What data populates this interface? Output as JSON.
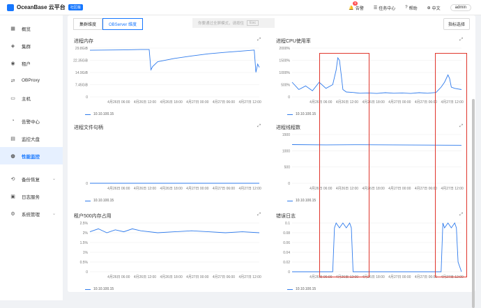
{
  "brand": {
    "name": "OceanBase 云平台",
    "edition": "社区版"
  },
  "topbar": {
    "alerts_label": "告警",
    "alerts_count": "9",
    "tasks_label": "任务中心",
    "help_label": "帮助",
    "lang_label": "中文",
    "user": "admin"
  },
  "sidebar": {
    "items": [
      {
        "label": "概览",
        "icon": "grid-icon"
      },
      {
        "label": "集群",
        "icon": "cluster-icon"
      },
      {
        "label": "租户",
        "icon": "tenant-icon"
      },
      {
        "label": "OBProxy",
        "icon": "proxy-icon"
      },
      {
        "label": "主机",
        "icon": "host-icon"
      },
      {
        "label": "告警中心",
        "icon": "bell-icon"
      },
      {
        "label": "监控大盘",
        "icon": "dashboard-icon"
      },
      {
        "label": "性能监控",
        "icon": "performance-icon",
        "active": true
      },
      {
        "label": "备份恢复",
        "icon": "backup-icon",
        "chevron": true
      },
      {
        "label": "日志服务",
        "icon": "log-icon"
      },
      {
        "label": "系统管理",
        "icon": "settings-icon",
        "chevron": true
      }
    ]
  },
  "tabs": [
    {
      "label": "集群维度"
    },
    {
      "label": "OBServer 维度",
      "selected": true
    }
  ],
  "toast": {
    "text": "你要通过全屏模式，请按住",
    "key": "Esc"
  },
  "metric_button": "指标选择",
  "legend_host": "10.10.100.15",
  "colors": {
    "line": "#2f7bec",
    "accent": "#1677ff",
    "highlight": "#e0352b"
  },
  "chart_data": [
    {
      "title": "进程内存",
      "type": "line",
      "y_ticks": [
        "29.8GiB",
        "22.35GiB",
        "14.9GiB",
        "7.45GiB",
        "0"
      ],
      "ylim": [
        0,
        29.8
      ],
      "x_ticks": [
        "4月26日 06:00",
        "4月26日 12:00",
        "4月26日 18:00",
        "4月27日 00:00",
        "4月27日 06:00",
        "4月27日 12:00"
      ],
      "series": [
        {
          "name": "10.10.100.15",
          "x": [
            0,
            0.1,
            0.2,
            0.3,
            0.35,
            0.36,
            0.37,
            0.4,
            0.5,
            0.6,
            0.7,
            0.8,
            0.9,
            0.97,
            0.98,
            0.99,
            1.0
          ],
          "values": [
            28.5,
            28.6,
            28.7,
            28.9,
            28.9,
            16.5,
            18.5,
            21.5,
            23.5,
            25.0,
            26.3,
            27.2,
            28.0,
            28.6,
            15.0,
            20.0,
            18.0
          ]
        }
      ]
    },
    {
      "title": "进程CPU使用率",
      "type": "line",
      "y_ticks": [
        "2000%",
        "1500%",
        "1000%",
        "500%",
        "0"
      ],
      "ylim": [
        0,
        2000
      ],
      "x_ticks": [
        "4月26日 06:00",
        "4月26日 12:00",
        "4月26日 18:00",
        "4月27日 00:00",
        "4月27日 06:00",
        "4月27日 12:00"
      ],
      "series": [
        {
          "name": "10.10.100.15",
          "x": [
            0,
            0.04,
            0.08,
            0.12,
            0.16,
            0.2,
            0.24,
            0.26,
            0.27,
            0.28,
            0.29,
            0.3,
            0.32,
            0.36,
            0.4,
            0.45,
            0.5,
            0.55,
            0.6,
            0.65,
            0.7,
            0.75,
            0.8,
            0.85,
            0.88,
            0.9,
            0.92,
            0.93,
            0.94,
            0.96,
            1.0
          ],
          "values": [
            600,
            300,
            450,
            250,
            600,
            350,
            500,
            1100,
            1600,
            1500,
            900,
            300,
            200,
            180,
            150,
            160,
            140,
            170,
            150,
            160,
            140,
            170,
            150,
            180,
            400,
            600,
            900,
            750,
            400,
            350,
            300
          ]
        }
      ]
    },
    {
      "title": "进程文件句柄",
      "type": "line",
      "y_ticks": [
        "0"
      ],
      "ylim": [
        0,
        1
      ],
      "x_ticks": [
        "4月26日 06:00",
        "4月26日 12:00",
        "4月26日 18:00",
        "4月27日 00:00",
        "4月27日 06:00",
        "4月27日 12:00"
      ],
      "series": [
        {
          "name": "10.10.100.15",
          "x": [
            0,
            1
          ],
          "values": [
            0,
            0
          ]
        }
      ]
    },
    {
      "title": "进程线程数",
      "type": "line",
      "y_ticks": [
        "1500",
        "1000",
        "500",
        "0"
      ],
      "ylim": [
        0,
        1500
      ],
      "x_ticks": [
        "4月26日 06:00",
        "4月26日 12:00",
        "4月26日 18:00",
        "4月27日 00:00",
        "4月27日 06:00",
        "4月27日 12:00"
      ],
      "series": [
        {
          "name": "10.10.100.15",
          "x": [
            0,
            0.2,
            0.4,
            0.6,
            0.8,
            1
          ],
          "values": [
            1190,
            1180,
            1185,
            1180,
            1175,
            1170
          ]
        }
      ]
    },
    {
      "title": "租户500内存占用",
      "type": "line",
      "y_ticks": [
        "2.5%",
        "2%",
        "1.5%",
        "1%",
        "0.5%",
        "0"
      ],
      "ylim": [
        0,
        2.5
      ],
      "x_ticks": [
        "4月26日 06:00",
        "4月26日 12:00",
        "4月26日 18:00",
        "4月27日 00:00",
        "4月27日 06:00",
        "4月27日 12:00"
      ],
      "series": [
        {
          "name": "10.10.100.15",
          "x": [
            0,
            0.05,
            0.1,
            0.15,
            0.2,
            0.25,
            0.3,
            0.4,
            0.5,
            0.6,
            0.7,
            0.8,
            0.9,
            1
          ],
          "values": [
            2.05,
            2.2,
            2.0,
            2.15,
            2.05,
            2.2,
            2.1,
            2.0,
            2.05,
            2.1,
            2.05,
            2.0,
            2.05,
            2.0
          ]
        }
      ]
    },
    {
      "title": "错误日志",
      "type": "line",
      "y_ticks": [
        "0.1",
        "0.08",
        "0.06",
        "0.04",
        "0.02",
        "0"
      ],
      "ylim": [
        0,
        0.1
      ],
      "x_ticks": [
        "4月26日 06:00",
        "4月26日 12:00",
        "4月26日 18:00",
        "4月27日 00:00",
        "4月27日 06:00",
        "4月27日 12:00"
      ],
      "series": [
        {
          "name": "10.10.100.15",
          "x": [
            0,
            0.24,
            0.25,
            0.26,
            0.28,
            0.3,
            0.32,
            0.34,
            0.35,
            0.36,
            0.88,
            0.89,
            0.9,
            0.92,
            0.94,
            0.96,
            0.97,
            0.98,
            1.0
          ],
          "values": [
            0,
            0,
            0.09,
            0.1,
            0.09,
            0.1,
            0.09,
            0.1,
            0.09,
            0,
            0,
            0.1,
            0.09,
            0.1,
            0.09,
            0.1,
            0.09,
            0.02,
            0
          ]
        }
      ]
    }
  ]
}
